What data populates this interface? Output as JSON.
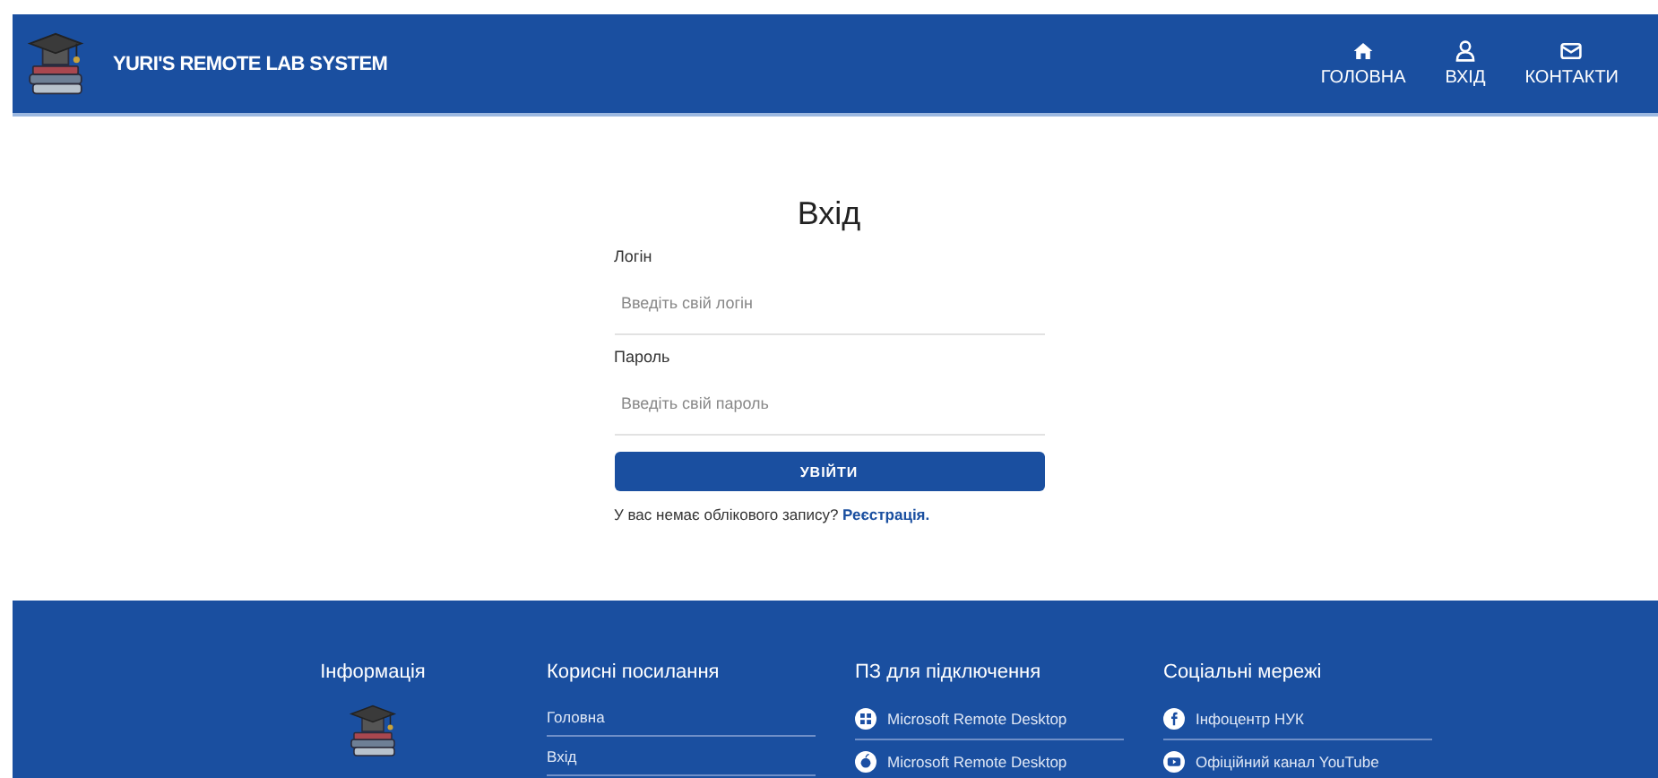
{
  "header": {
    "title": "YURI'S REMOTE LAB SYSTEM",
    "nav": [
      {
        "label": "ГОЛОВНА",
        "kind": "home"
      },
      {
        "label": "ВХІД",
        "kind": "user"
      },
      {
        "label": "КОНТАКТИ",
        "kind": "mail"
      }
    ]
  },
  "login": {
    "title": "Вхід",
    "fields": [
      {
        "label": "Логін",
        "placeholder": "Введіть свій логін"
      },
      {
        "label": "Пароль",
        "placeholder": "Введіть свій пароль"
      }
    ],
    "button": "УВІЙТИ",
    "note": "У вас немає облікового запису?",
    "link": "Реєстрація."
  },
  "footer": {
    "columns": [
      {
        "title": "Інформація",
        "kind": "logo"
      },
      {
        "title": "Корисні посилання",
        "kind": "links",
        "items": [
          {
            "label": "Головна",
            "kind": "none"
          },
          {
            "label": "Вхід",
            "kind": "none"
          }
        ]
      },
      {
        "title": "ПЗ для підключення",
        "kind": "links",
        "items": [
          {
            "label": "Microsoft Remote Desktop",
            "kind": "windows"
          },
          {
            "label": "Microsoft Remote Desktop",
            "kind": "apple"
          }
        ]
      },
      {
        "title": "Соціальні мережі",
        "kind": "links",
        "items": [
          {
            "label": "Інфоцентр НУК",
            "kind": "facebook"
          },
          {
            "label": "Офіційний канал YouTube",
            "kind": "youtube"
          }
        ]
      }
    ]
  }
}
